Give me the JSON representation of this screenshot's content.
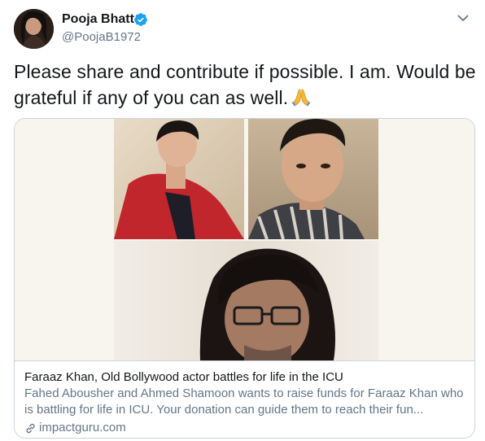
{
  "user": {
    "display_name": "Pooja Bhatt",
    "handle": "@PoojaB1972",
    "verified": true
  },
  "tweet": {
    "text": "Please share and contribute if possible. I am. Would be grateful if any of you can as well.",
    "emoji": "🙏"
  },
  "card": {
    "title": "Faraaz Khan, Old Bollywood actor battles for life in the ICU",
    "description": "Fahed Abousher and Ahmed Shamoon wants to raise funds for Faraaz Khan who is battling for life in ICU. Your donation can guide them to reach their fun...",
    "domain": "impactguru.com"
  },
  "icons": {
    "verified": "verified-badge-icon",
    "more": "chevron-down-icon",
    "link": "link-icon",
    "emoji": "folded-hands-emoji"
  },
  "colors": {
    "text_primary": "#14171a",
    "text_secondary": "#657786",
    "verified_blue": "#1da1f2",
    "border": "#ccd6dd"
  }
}
